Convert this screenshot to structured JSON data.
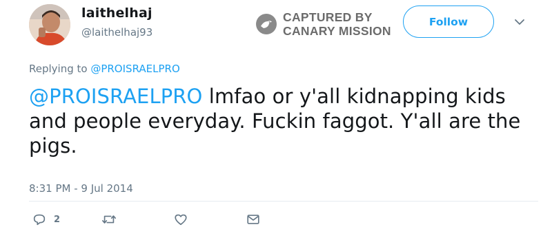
{
  "user": {
    "display_name": "laithelhaj",
    "handle": "@laithelhaj93"
  },
  "stamp": {
    "line1": "CAPTURED BY",
    "line2": "CANARY MISSION"
  },
  "follow_label": "Follow",
  "reply_context": {
    "prefix": "Replying to ",
    "target": "@PROISRAELPRO"
  },
  "tweet": {
    "mention": "@PROISRAELPRO",
    "body": " lmfao or y'all kidnapping kids and people everyday. Fuckin faggot. Y'all are the pigs."
  },
  "timestamp": "8:31 PM - 9 Jul 2014",
  "actions": {
    "reply_count": "2"
  },
  "colors": {
    "accent": "#1da1f2",
    "secondary_text": "#657786",
    "primary_text": "#14171a"
  },
  "icons": [
    "reply-icon",
    "retweet-icon",
    "like-icon",
    "direct-message-icon",
    "chevron-down-icon",
    "canary-bird-icon"
  ]
}
